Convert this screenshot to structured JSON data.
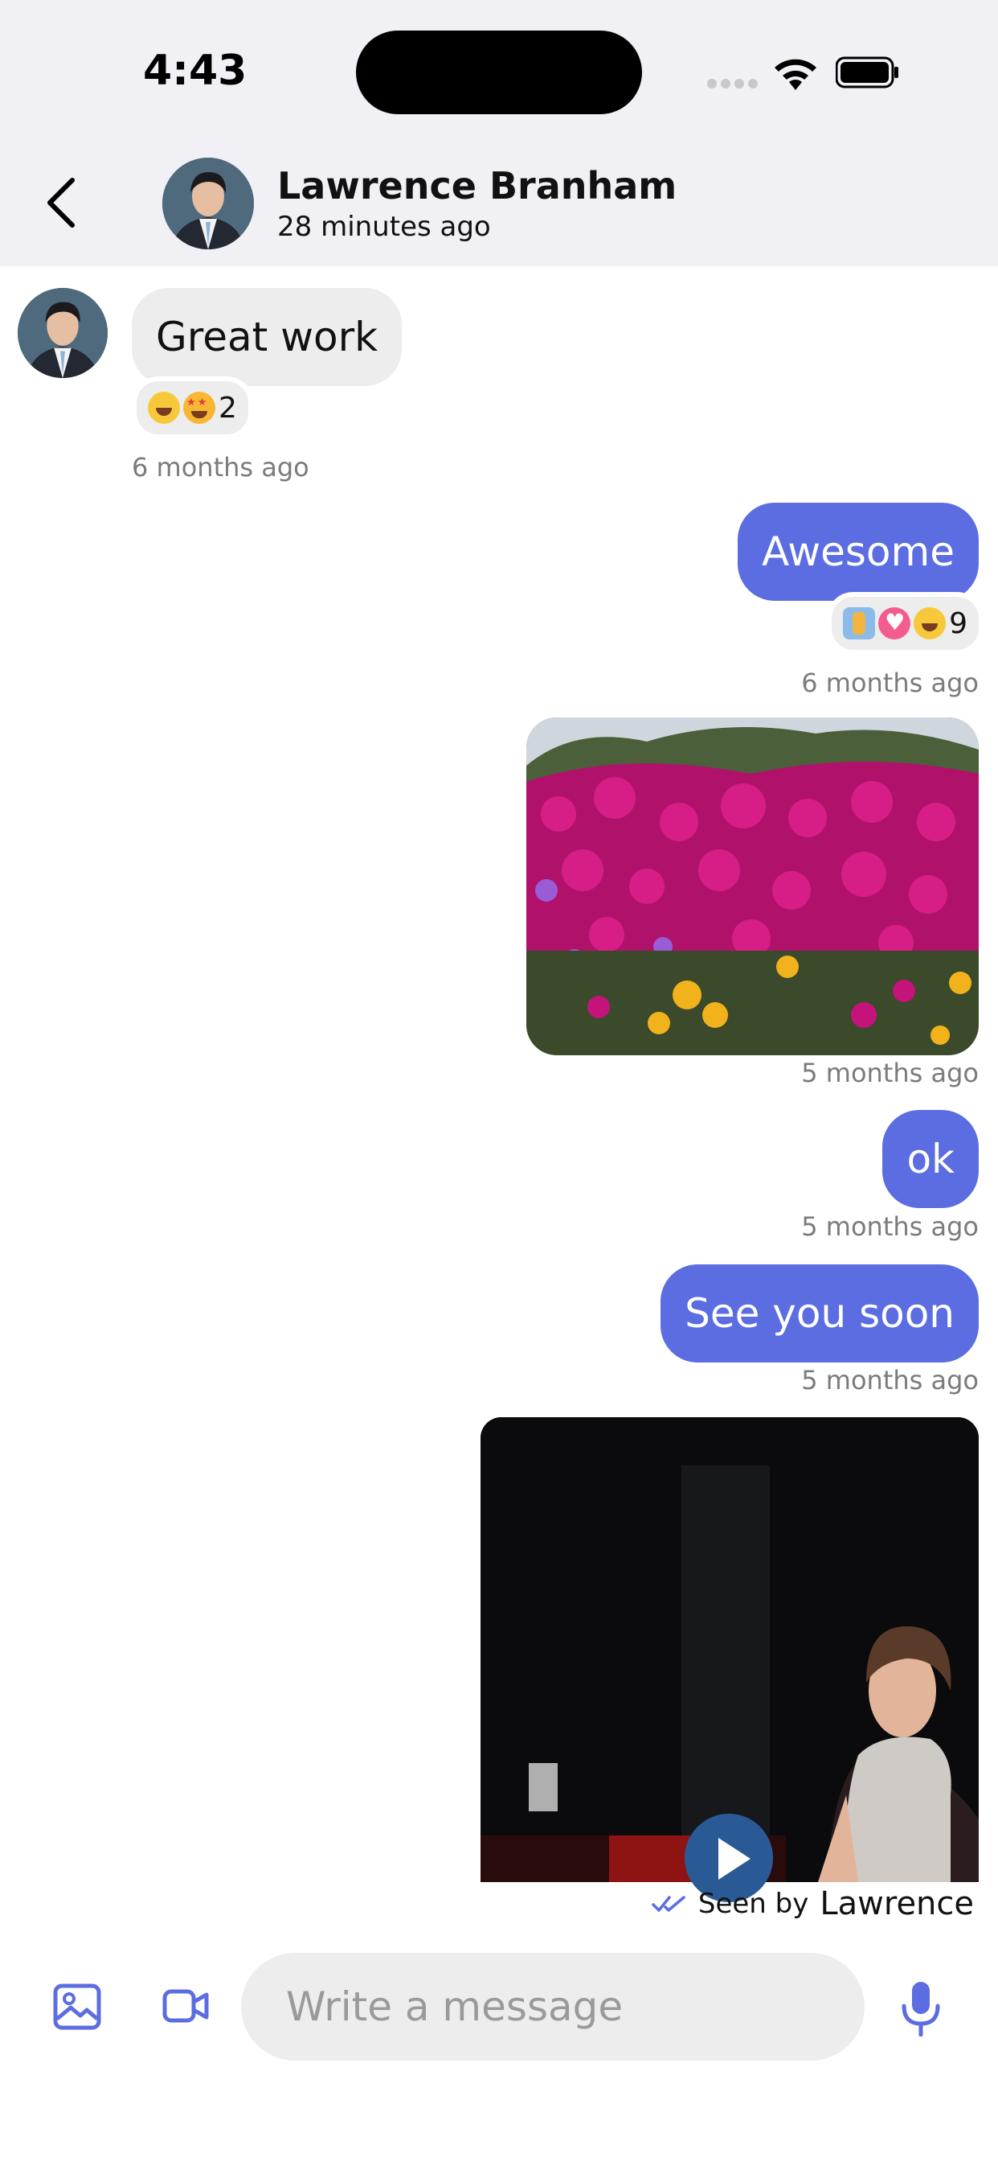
{
  "status_bar": {
    "time": "4:43"
  },
  "header": {
    "name": "Lawrence Branham",
    "subtitle": "28 minutes ago"
  },
  "messages": [
    {
      "direction": "incoming",
      "type": "text",
      "text": "Great work",
      "reaction_count": "2",
      "reactions": [
        "laughing-face",
        "star-struck-face"
      ],
      "time": "6 months ago"
    },
    {
      "direction": "outgoing",
      "type": "text",
      "text": "Awesome",
      "reaction_count": "9",
      "reactions": [
        "clapping-hands",
        "heart",
        "laughing-face"
      ],
      "time": "6 months ago"
    },
    {
      "direction": "outgoing",
      "type": "image",
      "time": "5 months ago"
    },
    {
      "direction": "outgoing",
      "type": "text",
      "text": "ok",
      "time": "5 months ago"
    },
    {
      "direction": "outgoing",
      "type": "text",
      "text": "See you soon",
      "time": "5 months ago"
    },
    {
      "direction": "outgoing",
      "type": "video"
    }
  ],
  "seen": {
    "label": "Seen by",
    "name": "Lawrence"
  },
  "composer": {
    "placeholder": "Write a message"
  },
  "colors": {
    "accent": "#5b6de0",
    "incoming_bubble": "#ededed",
    "header_bg": "#f0f0f5"
  }
}
